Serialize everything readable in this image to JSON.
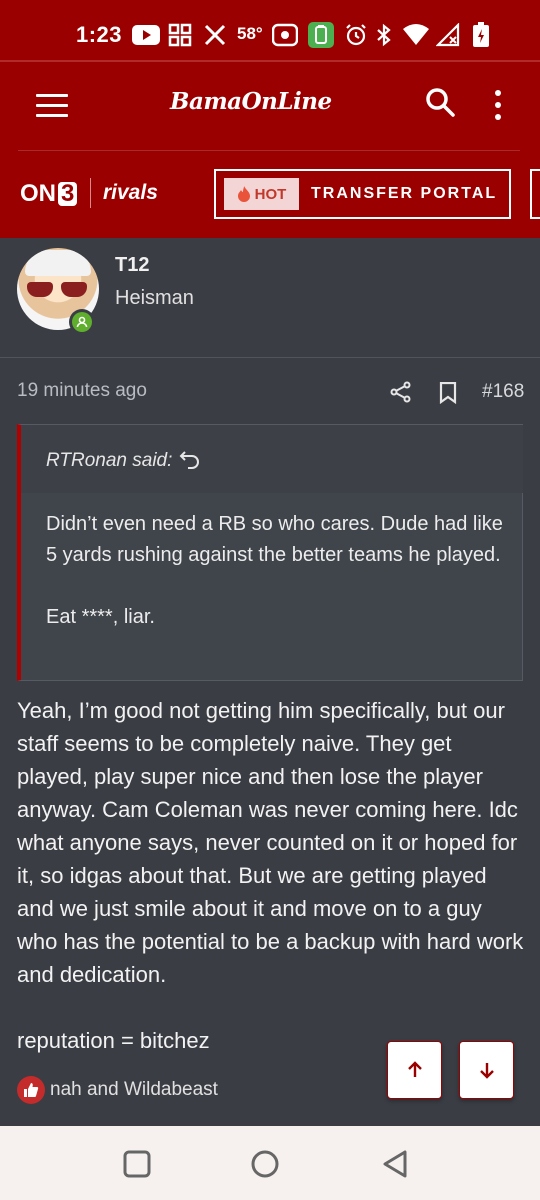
{
  "status_bar": {
    "time": "1:23",
    "temperature": "58°",
    "icons": [
      "youtube-icon",
      "apps-icon",
      "x-icon",
      "radio-icon",
      "battery-saver-icon",
      "alarm-icon",
      "bluetooth-icon",
      "wifi-icon",
      "signal-icon",
      "battery-icon"
    ]
  },
  "header": {
    "logo": "BamaOnLine",
    "on3_prefix": "ON",
    "on3_digit": "3",
    "rivals": "rivals",
    "hot_label": "HOT",
    "portal_label": "TRANSFER PORTAL"
  },
  "user": {
    "name": "T12",
    "rank": "Heisman"
  },
  "post": {
    "time_ago": "19 minutes ago",
    "number": "#168",
    "quote": {
      "author": "RTRonan said:",
      "paragraph1": "Didn’t even need a RB so who cares. Dude had like 5 yards rushing against the better teams he played.",
      "paragraph2": "Eat ****, liar."
    },
    "paragraph1": "Yeah, I’m good not getting him specifically, but our staff seems to be completely naive. They get played, play super nice and then lose the player anyway. Cam Coleman was never coming here. Idc what anyone says, never counted on it or hoped for it, so idgas about that. But we are getting played and we just smile about it and move on to a guy who has the potential to be a backup with hard work and dedication.",
    "paragraph2": "reputation = bitchez",
    "reactions": "nah and Wildabeast"
  },
  "colors": {
    "brand_red": "#9b0000",
    "background": "#3a3d44",
    "online_green": "#5fae2e"
  }
}
